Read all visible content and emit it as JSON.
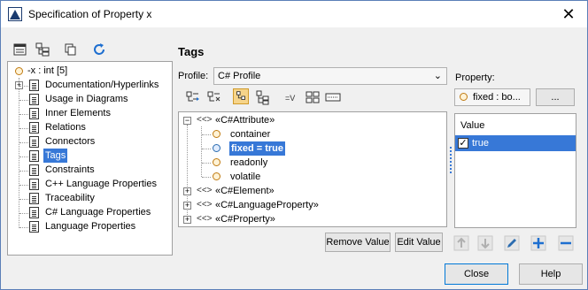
{
  "window": {
    "title": "Specification of Property x"
  },
  "left_tree": {
    "root": "-x : int [5]",
    "items": [
      "Documentation/Hyperlinks",
      "Usage in Diagrams",
      "Inner Elements",
      "Relations",
      "Connectors",
      "Tags",
      "Constraints",
      "C++ Language Properties",
      "Traceability",
      "C# Language Properties",
      "Language Properties"
    ]
  },
  "main": {
    "heading": "Tags",
    "profile_label": "Profile:",
    "profile_value": "C# Profile",
    "property_label": "Property:",
    "property_value": "fixed : bo...",
    "more_button": "...",
    "tags_tree": {
      "groups": [
        {
          "label": "«C#Attribute»",
          "children": [
            "container",
            "fixed = true",
            "readonly",
            "volatile"
          ]
        },
        {
          "label": "«C#Element»"
        },
        {
          "label": "«C#LanguageProperty»"
        },
        {
          "label": "«C#Property»"
        }
      ]
    },
    "remove_value": "Remove Value",
    "edit_value": "Edit Value",
    "value_header": "Value",
    "value_row": "true"
  },
  "footer": {
    "close": "Close",
    "help": "Help"
  }
}
